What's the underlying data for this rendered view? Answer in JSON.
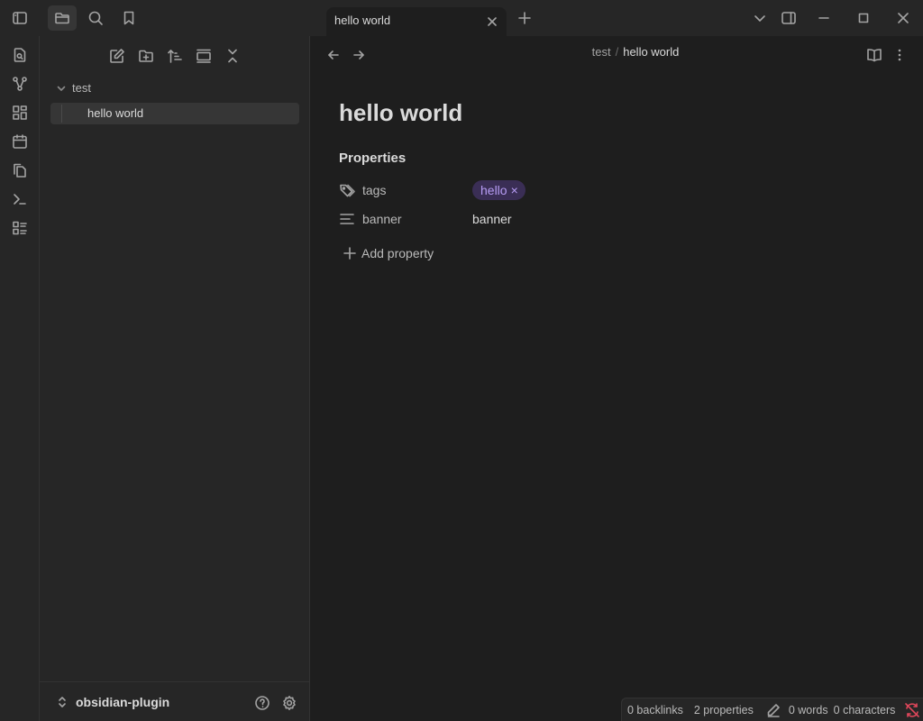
{
  "titlebar": {
    "tab_title": "hello world"
  },
  "ribbon": {
    "items": [
      "open-quick-switcher",
      "open-graph-view",
      "open-canvas",
      "open-daily-note",
      "insert-template",
      "open-command-palette",
      "bases"
    ]
  },
  "sidebar": {
    "folder": "test",
    "file": "hello world",
    "vault_name": "obsidian-plugin"
  },
  "main": {
    "breadcrumb_folder": "test",
    "breadcrumb_separator": "/",
    "breadcrumb_file": "hello world",
    "title": "hello world",
    "properties_heading": "Properties",
    "properties": {
      "tags_key": "tags",
      "tag_value": "hello",
      "tag_remove": "×",
      "banner_key": "banner",
      "banner_value": "banner"
    },
    "add_property_label": "Add property"
  },
  "status": {
    "backlinks": "0 backlinks",
    "properties": "2 properties",
    "words": "0 words",
    "characters": "0 characters"
  },
  "colors": {
    "accent": "#b69cf4",
    "tag_bg": "#3a2e55",
    "sync_error": "#e0475b"
  }
}
